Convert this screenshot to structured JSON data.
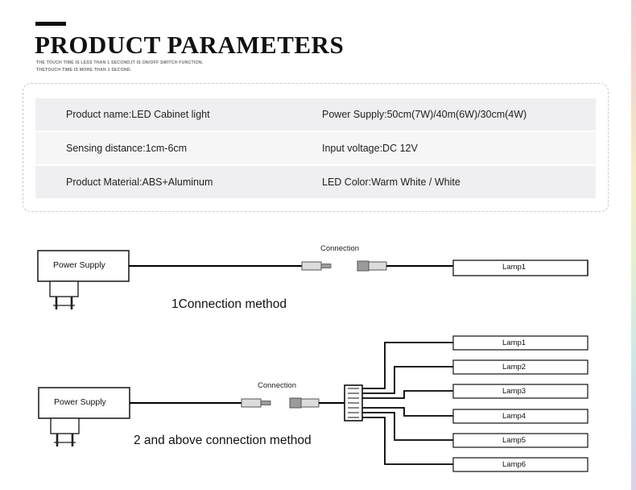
{
  "header": {
    "title": "PRODUCT PARAMETERS",
    "subtitle_line1": "THE TOUCH TIME IS LESS THAN 1 SECOND,IT IS ON/OFF SWITCH FUNCTION.",
    "subtitle_line2": "THETOUCH TIME IS MORE THAN 1 SECOND."
  },
  "spec_table": {
    "rows": [
      {
        "left": "Product name:LED Cabinet light",
        "right": "Power Supply:50cm(7W)/40m(6W)/30cm(4W)"
      },
      {
        "left": "Sensing distance:1cm-6cm",
        "right": "Input voltage:DC 12V"
      },
      {
        "left": "Product Material:ABS+Aluminum",
        "right": "LED Color:Warm White / White"
      }
    ]
  },
  "diagram1": {
    "power_supply_label": "Power Supply",
    "connection_label": "Connection",
    "lamp_label": "Lamp1",
    "caption": "1Connection method"
  },
  "diagram2": {
    "power_supply_label": "Power Supply",
    "connection_label": "Connection",
    "caption": "2 and above connection method",
    "lamps": [
      "Lamp1",
      "Lamp2",
      "Lamp3",
      "Lamp4",
      "Lamp5",
      "Lamp6"
    ]
  },
  "colors": {
    "title": "#111111",
    "row_bg": "#efeff1",
    "row_bg_alt": "#f6f6f7",
    "box_border": "#c9c9c9",
    "line": "#000000"
  }
}
